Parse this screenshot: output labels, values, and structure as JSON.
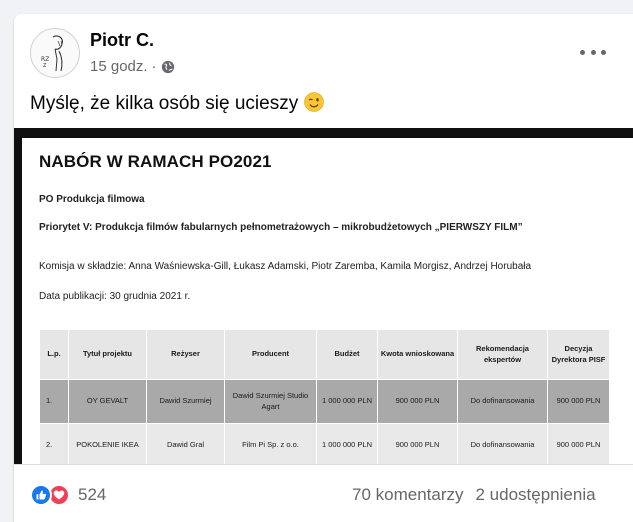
{
  "post": {
    "author": "Piotr C.",
    "time": "15 godz.",
    "dot": "·",
    "text": "Myślę, że kilka osób się ucieszy",
    "icons": {
      "privacy": "globe-icon",
      "emoji": "wink-emoji-icon",
      "more": "more-options-icon"
    }
  },
  "document": {
    "title": "NABÓR W RAMACH PO2021",
    "program": "PO Produkcja filmowa",
    "priority": "Priorytet V: Produkcja filmów fabularnych pełnometrażowych – mikrobudżetowych „PIERWSZY FILM”",
    "commission": "Komisja w składzie: Anna Waśniewska-Gill, Łukasz Adamski, Piotr Zaremba, Kamila Morgisz, Andrzej Horubała",
    "publication_date": "Data publikacji: 30 grudnia 2021 r.",
    "table": {
      "headers": [
        "L.p.",
        "Tytuł projektu",
        "Reżyser",
        "Producent",
        "Budżet",
        "Kwota wnioskowana",
        "Rekomendacja ekspertów",
        "Decyzja Dyrektora PISF"
      ],
      "rows": [
        [
          "1.",
          "OY GEVALT",
          "Dawid Szurmiej",
          "Dawid Szurmiej Studio Agart",
          "1 000 000 PLN",
          "900 000 PLN",
          "Do dofinansowania",
          "900 000 PLN"
        ],
        [
          "2.",
          "POKOLENIE IKEA",
          "Dawid Gral",
          "Film Pi Sp. z o.o.",
          "1 000 000 PLN",
          "900 000 PLN",
          "Do dofinansowania",
          "900 000 PLN"
        ]
      ]
    }
  },
  "engagement": {
    "reaction_count": "524",
    "comments": "70 komentarzy",
    "shares": "2 udostępnienia",
    "reaction_icons": [
      "like-icon",
      "love-icon"
    ],
    "colors": {
      "like": "#1877f2",
      "love": "#f33e58"
    }
  }
}
